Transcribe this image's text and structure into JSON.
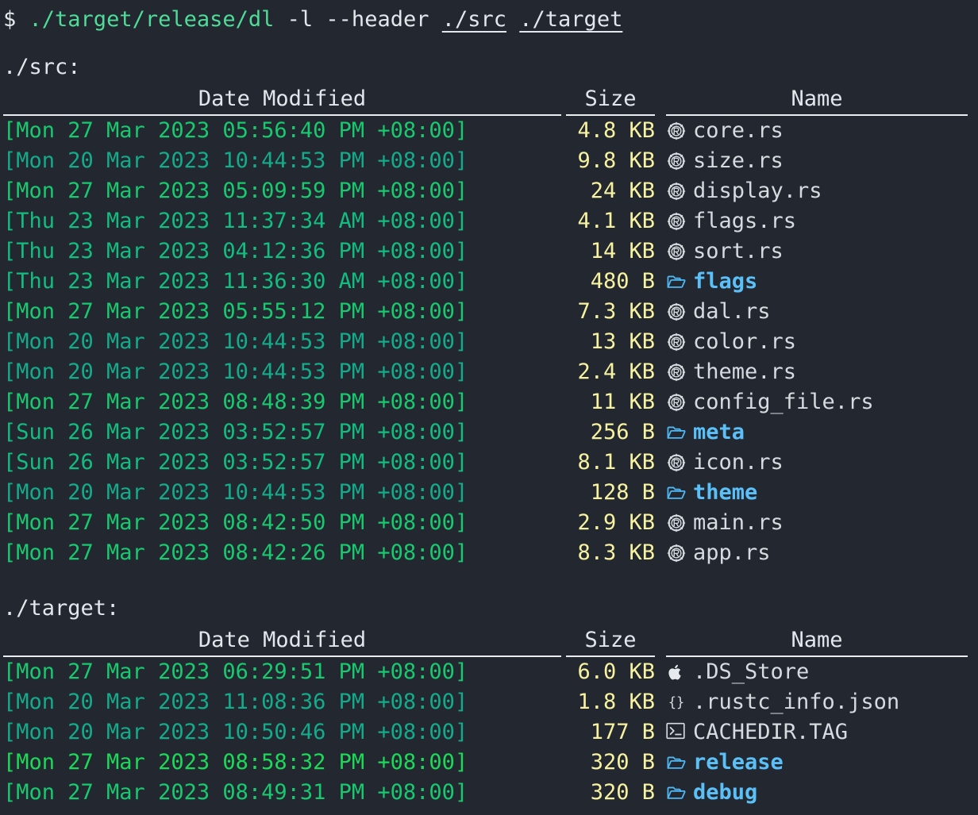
{
  "terminal": {
    "background": "#232830",
    "prompt_symbol": "$",
    "command": {
      "binary": "./target/release/dl",
      "flags": "-l --header",
      "args": [
        "./src",
        "./target"
      ]
    }
  },
  "colors": {
    "prompt": "#e6eaee",
    "command_path": "#4fdb98",
    "size": "#f6f2a0",
    "file_name": "#d6dbe0",
    "dir_name": "#5bc0f8",
    "header": "#e2e7ec",
    "date_hot": "#1cd95a",
    "date_warm": "#18c96f",
    "date_mid": "#13bd80",
    "date_cool": "#14ab8b"
  },
  "headers": {
    "date": "Date Modified",
    "size": "Size",
    "name": "Name"
  },
  "sections": [
    {
      "label": "./src:",
      "rows": [
        {
          "date": "[Mon 27 Mar 2023 05:56:40 PM +08:00]",
          "date_class": "d-warm",
          "size_num": "4.8",
          "size_unit": "KB",
          "icon": "rust-icon",
          "name": "core.rs",
          "name_class": "n-file"
        },
        {
          "date": "[Mon 20 Mar 2023 10:44:53 PM +08:00]",
          "date_class": "d-cool",
          "size_num": "9.8",
          "size_unit": "KB",
          "icon": "rust-icon",
          "name": "size.rs",
          "name_class": "n-file"
        },
        {
          "date": "[Mon 27 Mar 2023 05:09:59 PM +08:00]",
          "date_class": "d-warm",
          "size_num": "24",
          "size_unit": "KB",
          "icon": "rust-icon",
          "name": "display.rs",
          "name_class": "n-file"
        },
        {
          "date": "[Thu 23 Mar 2023 11:37:34 AM +08:00]",
          "date_class": "d-mid",
          "size_num": "4.1",
          "size_unit": "KB",
          "icon": "rust-icon",
          "name": "flags.rs",
          "name_class": "n-file"
        },
        {
          "date": "[Thu 23 Mar 2023 04:12:36 PM +08:00]",
          "date_class": "d-mid",
          "size_num": "14",
          "size_unit": "KB",
          "icon": "rust-icon",
          "name": "sort.rs",
          "name_class": "n-file"
        },
        {
          "date": "[Thu 23 Mar 2023 11:36:30 AM +08:00]",
          "date_class": "d-mid",
          "size_num": "480",
          "size_unit": "B",
          "icon": "folder-icon",
          "name": "flags",
          "name_class": "n-dir"
        },
        {
          "date": "[Mon 27 Mar 2023 05:55:12 PM +08:00]",
          "date_class": "d-warm",
          "size_num": "7.3",
          "size_unit": "KB",
          "icon": "rust-icon",
          "name": "dal.rs",
          "name_class": "n-file"
        },
        {
          "date": "[Mon 20 Mar 2023 10:44:53 PM +08:00]",
          "date_class": "d-cool",
          "size_num": "13",
          "size_unit": "KB",
          "icon": "rust-icon",
          "name": "color.rs",
          "name_class": "n-file"
        },
        {
          "date": "[Mon 20 Mar 2023 10:44:53 PM +08:00]",
          "date_class": "d-cool",
          "size_num": "2.4",
          "size_unit": "KB",
          "icon": "rust-icon",
          "name": "theme.rs",
          "name_class": "n-file"
        },
        {
          "date": "[Mon 27 Mar 2023 08:48:39 PM +08:00]",
          "date_class": "d-warm",
          "size_num": "11",
          "size_unit": "KB",
          "icon": "rust-icon",
          "name": "config_file.rs",
          "name_class": "n-file"
        },
        {
          "date": "[Sun 26 Mar 2023 03:52:57 PM +08:00]",
          "date_class": "d-mid",
          "size_num": "256",
          "size_unit": "B",
          "icon": "folder-icon",
          "name": "meta",
          "name_class": "n-dir"
        },
        {
          "date": "[Sun 26 Mar 2023 03:52:57 PM +08:00]",
          "date_class": "d-mid",
          "size_num": "8.1",
          "size_unit": "KB",
          "icon": "rust-icon",
          "name": "icon.rs",
          "name_class": "n-file"
        },
        {
          "date": "[Mon 20 Mar 2023 10:44:53 PM +08:00]",
          "date_class": "d-cool",
          "size_num": "128",
          "size_unit": "B",
          "icon": "folder-icon",
          "name": "theme",
          "name_class": "n-dir"
        },
        {
          "date": "[Mon 27 Mar 2023 08:42:50 PM +08:00]",
          "date_class": "d-warm",
          "size_num": "2.9",
          "size_unit": "KB",
          "icon": "rust-icon",
          "name": "main.rs",
          "name_class": "n-file"
        },
        {
          "date": "[Mon 27 Mar 2023 08:42:26 PM +08:00]",
          "date_class": "d-warm",
          "size_num": "8.3",
          "size_unit": "KB",
          "icon": "rust-icon",
          "name": "app.rs",
          "name_class": "n-file"
        }
      ]
    },
    {
      "label": "./target:",
      "rows": [
        {
          "date": "[Mon 27 Mar 2023 06:29:51 PM +08:00]",
          "date_class": "d-warm",
          "size_num": "6.0",
          "size_unit": "KB",
          "icon": "apple-icon",
          "name": ".DS_Store",
          "name_class": "n-file"
        },
        {
          "date": "[Mon 20 Mar 2023 11:08:36 PM +08:00]",
          "date_class": "d-cool",
          "size_num": "1.8",
          "size_unit": "KB",
          "icon": "json-icon",
          "name": ".rustc_info.json",
          "name_class": "n-file"
        },
        {
          "date": "[Mon 20 Mar 2023 10:50:46 PM +08:00]",
          "date_class": "d-cool",
          "size_num": "177",
          "size_unit": "B",
          "icon": "terminal-icon",
          "name": "CACHEDIR.TAG",
          "name_class": "n-file"
        },
        {
          "date": "[Mon 27 Mar 2023 08:58:32 PM +08:00]",
          "date_class": "d-hot",
          "size_num": "320",
          "size_unit": "B",
          "icon": "folder-icon",
          "name": "release",
          "name_class": "n-dir"
        },
        {
          "date": "[Mon 27 Mar 2023 08:49:31 PM +08:00]",
          "date_class": "d-warm",
          "size_num": "320",
          "size_unit": "B",
          "icon": "folder-icon",
          "name": "debug",
          "name_class": "n-dir"
        }
      ]
    }
  ]
}
